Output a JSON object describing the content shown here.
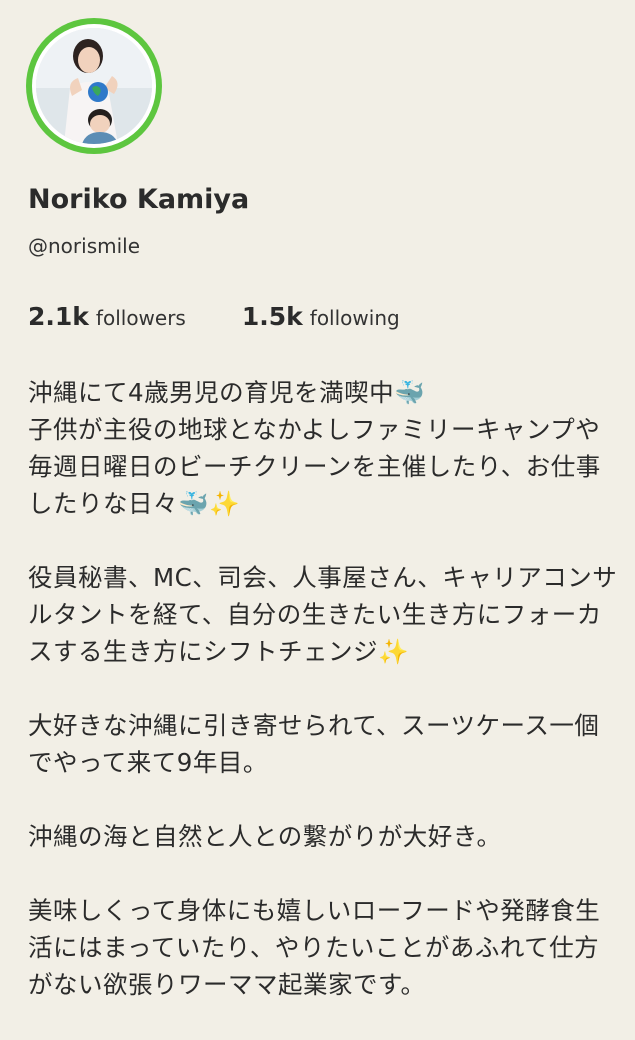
{
  "profile": {
    "name": "Noriko Kamiya",
    "handle": "@norismile",
    "avatar_ring_color": "#5dc63f"
  },
  "stats": {
    "followers_count": "2.1k",
    "followers_label": "followers",
    "following_count": "1.5k",
    "following_label": "following"
  },
  "bio": {
    "line1": "沖縄にて4歳男児の育児を満喫中🐳",
    "line2": "子供が主役の地球となかよしファミリーキャンプや毎週日曜日のビーチクリーンを主催したり、お仕事したりな日々🐳✨",
    "para2": "役員秘書、MC、司会、人事屋さん、キャリアコンサルタントを経て、自分の生きたい生き方にフォーカスする生き方にシフトチェンジ✨",
    "para3": "大好きな沖縄に引き寄せられて、スーツケース一個でやって来て9年目。",
    "para4": "沖縄の海と自然と人との繋がりが大好き。",
    "para5": "美味しくって身体にも嬉しいローフードや発酵食生活にはまっていたり、やりたいことがあふれて仕方がない欲張りワーママ起業家です。"
  }
}
